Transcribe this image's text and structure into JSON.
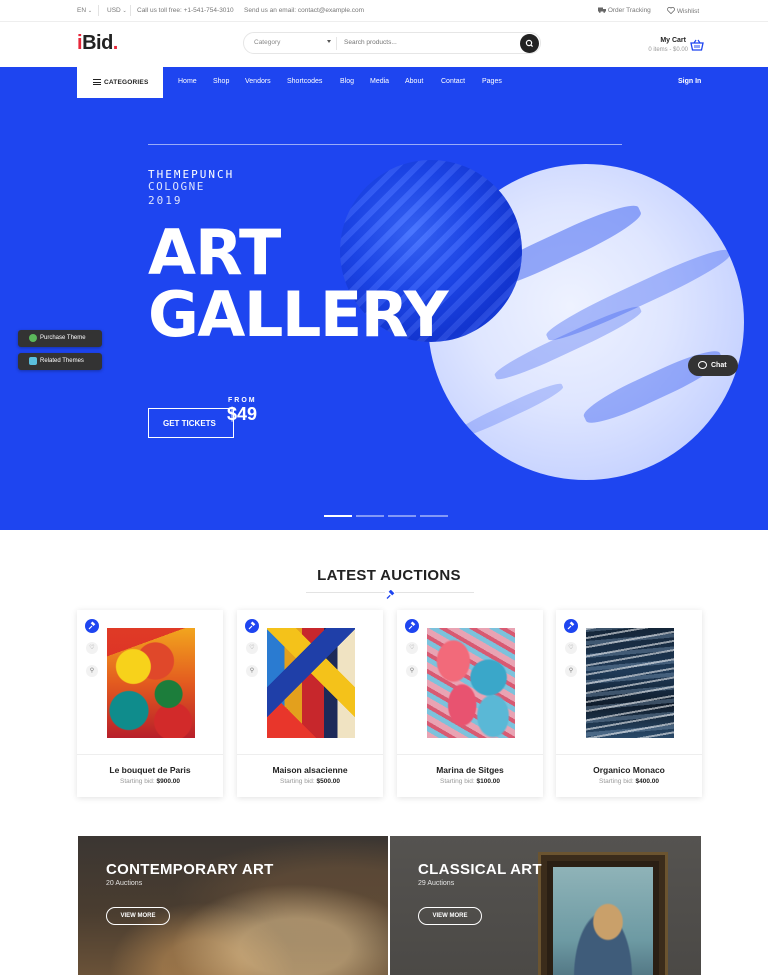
{
  "topbar": {
    "language": "EN",
    "currency": "USD",
    "phone": "Call us toll free: +1-541-754-3010",
    "email": "Send us an email: contact@example.com",
    "order_tracking": "Order Tracking",
    "wishlist": "Wishlist"
  },
  "header": {
    "logo_i": "i",
    "logo_rest": "Bid",
    "logo_dot": ".",
    "search_category": "Category",
    "search_placeholder": "Search products...",
    "cart_title": "My Cart",
    "cart_sub": "0 items - $0.00"
  },
  "nav": {
    "categories": "CATEGORIES",
    "items": [
      "Home",
      "Shop",
      "Vendors",
      "Shortcodes",
      "Blog",
      "Media",
      "About",
      "Contact",
      "Pages"
    ],
    "sign_in": "Sign In"
  },
  "hero": {
    "brand": "THEMEPUNCH",
    "city": "COLOGNE",
    "year": "2019",
    "title_line1": "ART",
    "title_line2": "GALLERY",
    "cta": "GET TICKETS",
    "from": "FROM",
    "price": "$49",
    "active_slide": 1,
    "slide_count": 4
  },
  "side_tabs": {
    "purchase": "Purchase Theme",
    "related": "Related Themes"
  },
  "chat": {
    "label": "Chat"
  },
  "auctions": {
    "title": "LATEST AUCTIONS",
    "bid_label": "Starting bid:",
    "items": [
      {
        "name": "Le bouquet de Paris",
        "bid": "$900.00"
      },
      {
        "name": "Maison alsacienne",
        "bid": "$500.00"
      },
      {
        "name": "Marina de Sitges",
        "bid": "$100.00"
      },
      {
        "name": "Organico Monaco",
        "bid": "$400.00"
      }
    ]
  },
  "banners": [
    {
      "title": "CONTEMPORARY ART",
      "count": "20 Auctions",
      "button": "VIEW MORE"
    },
    {
      "title": "CLASSICAL ART",
      "count": "29 Auctions",
      "button": "VIEW MORE"
    }
  ],
  "colors": {
    "brand_blue": "#1e45f0",
    "logo_red": "#e7283a"
  }
}
